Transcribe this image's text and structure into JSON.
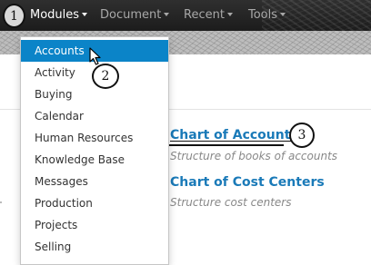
{
  "navbar": {
    "items": [
      {
        "label": "Modules",
        "active": true
      },
      {
        "label": "Document",
        "active": false
      },
      {
        "label": "Recent",
        "active": false
      },
      {
        "label": "Tools",
        "active": false
      }
    ]
  },
  "annotations": {
    "step1": "1",
    "step2": "2",
    "step3": "3"
  },
  "modules_menu": {
    "items": [
      {
        "label": "Accounts",
        "highlighted": true
      },
      {
        "label": "Activity"
      },
      {
        "label": "Buying"
      },
      {
        "label": "Calendar"
      },
      {
        "label": "Human Resources"
      },
      {
        "label": "Knowledge Base"
      },
      {
        "label": "Messages"
      },
      {
        "label": "Production"
      },
      {
        "label": "Projects"
      },
      {
        "label": "Selling"
      }
    ]
  },
  "content": {
    "links": [
      {
        "title": "Chart of Accounts",
        "description": "Structure of books of accounts"
      },
      {
        "title": "Chart of Cost Centers",
        "description": "Structure cost centers"
      }
    ]
  },
  "colors": {
    "highlight": "#0b84c8",
    "link": "#1a7ab8",
    "navbar": "#262626"
  }
}
